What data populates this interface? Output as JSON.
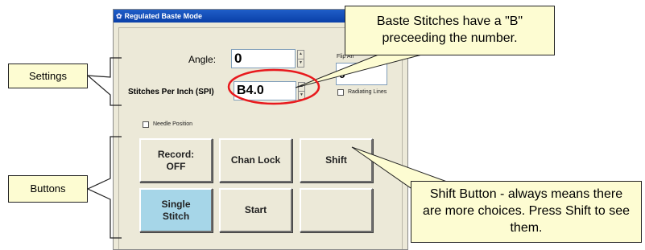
{
  "window": {
    "title": "Regulated Baste Mode"
  },
  "form": {
    "angle_label": "Angle:",
    "angle_value": "0",
    "spi_label": "Stitches Per Inch (SPI)",
    "spi_value": "B4.0",
    "flip_label": "Flip An",
    "flip_value": "0",
    "radiating_lines_label": "Radiating Lines",
    "needle_position_label": "Needle Position"
  },
  "buttons": [
    {
      "label": "Record:\nOFF"
    },
    {
      "label": "Chan Lock"
    },
    {
      "label": "Shift"
    },
    {
      "label": "Single\nStitch"
    },
    {
      "label": "Start"
    },
    {
      "label": ""
    }
  ],
  "callouts": {
    "settings": "Settings",
    "buttons": "Buttons",
    "baste": "Baste Stitches have a \"B\" preceeding the number.",
    "shift": "Shift Button - always means there are more choices. Press Shift to see them."
  },
  "colors": {
    "callout_fill": "#fdfcd2",
    "highlight_ring": "#e8191d",
    "title_bar": "#0a3fa8",
    "single_stitch_button": "#a6d6e8"
  }
}
